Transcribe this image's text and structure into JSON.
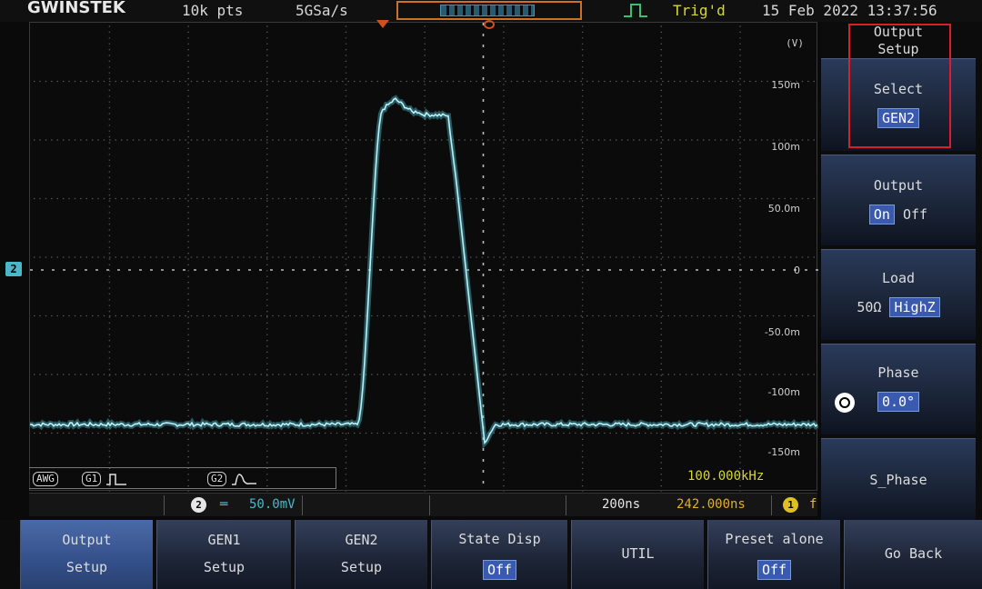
{
  "topbar": {
    "brand": "GWINSTEK",
    "record_length": "10k pts",
    "sample_rate": "5GSa/s",
    "trigger_status": "Trig'd",
    "datetime": "15 Feb 2022 13:37:56"
  },
  "plot": {
    "unit": "(V)",
    "y_labels": [
      "150m",
      "100m",
      "50.0m",
      "0",
      "-50.0m",
      "-100m",
      "-150m"
    ],
    "channel_marker": "2",
    "trace_color": "#4ab7c9"
  },
  "awg_bar": {
    "awg_label": "AWG",
    "gen1_label": "G1",
    "gen2_label": "G2",
    "frequency": "100.000kHz"
  },
  "status_bar": {
    "channel": "2",
    "scale": "50.0mV",
    "timebase": "200ns",
    "delay": "242.000ns",
    "trigger_source": "1",
    "trigger_edge": "f"
  },
  "side_menu": {
    "title": "Output Setup",
    "items": [
      {
        "label": "Select",
        "value": "GEN2"
      },
      {
        "label": "Output",
        "options": [
          "On",
          "Off"
        ],
        "selected": "On"
      },
      {
        "label": "Load",
        "options": [
          "50Ω",
          "HighZ"
        ],
        "selected": "HighZ"
      },
      {
        "label": "Phase",
        "value": "0.0°"
      },
      {
        "label": "S_Phase"
      }
    ]
  },
  "bottom_menu": [
    {
      "line1": "Output",
      "line2": "Setup"
    },
    {
      "line1": "GEN1",
      "line2": "Setup"
    },
    {
      "line1": "GEN2",
      "line2": "Setup"
    },
    {
      "line1": "State Disp",
      "value": "Off"
    },
    {
      "line1": "UTIL"
    },
    {
      "line1": "Preset alone",
      "value": "Off"
    },
    {
      "line1": "Go Back"
    }
  ]
}
